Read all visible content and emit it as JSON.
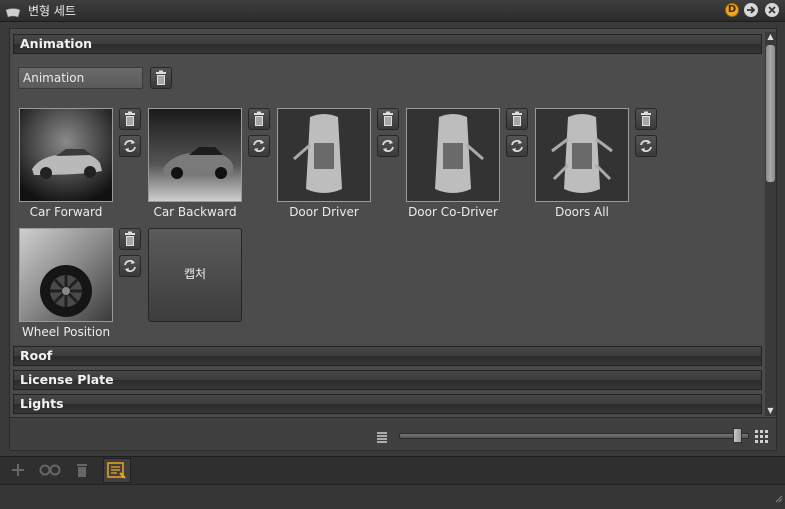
{
  "window": {
    "title": "변형 세트",
    "title_icon": "variant-set-icon",
    "buttons": [
      "D"
    ]
  },
  "sections": [
    {
      "label": "Animation",
      "expanded": true
    },
    {
      "label": "Roof",
      "expanded": false
    },
    {
      "label": "License Plate",
      "expanded": false
    },
    {
      "label": "Lights",
      "expanded": false
    }
  ],
  "animation": {
    "set_name": "Animation",
    "items": [
      {
        "label": "Car Forward",
        "icon": "car-front-three-quarter-thumbnail"
      },
      {
        "label": "Car Backward",
        "icon": "car-rear-three-quarter-thumbnail"
      },
      {
        "label": "Door Driver",
        "icon": "car-top-driver-door-open-thumbnail"
      },
      {
        "label": "Door Co-Driver",
        "icon": "car-top-codriver-door-open-thumbnail"
      },
      {
        "label": "Doors All",
        "icon": "car-top-all-doors-open-thumbnail"
      },
      {
        "label": "Wheel Position",
        "icon": "car-wheel-closeup-thumbnail"
      }
    ],
    "capture_label": "캡처"
  },
  "colors": {
    "accent": "#f0a51c",
    "panel": "#4a4a4a",
    "header": "#3a3a3a"
  },
  "bottom": {
    "slider_value": 0.98,
    "list_view_icon": "list-view-icon",
    "grid_view_icon": "grid-view-icon"
  },
  "toolbar": {
    "tools": [
      "add-icon",
      "link-icon",
      "delete-icon",
      "variant-set-editor-icon"
    ]
  }
}
